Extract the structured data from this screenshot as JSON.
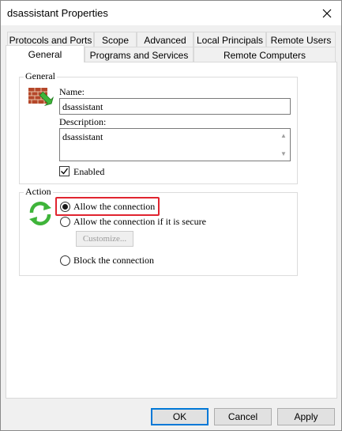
{
  "window": {
    "title": "dsassistant Properties"
  },
  "tabs_row1": [
    "Protocols and Ports",
    "Scope",
    "Advanced",
    "Local Principals",
    "Remote Users"
  ],
  "tabs_row2": [
    "General",
    "Programs and Services",
    "Remote Computers"
  ],
  "active_tab": "General",
  "general": {
    "label": "General",
    "name_label": "Name:",
    "name_value": "dsassistant",
    "description_label": "Description:",
    "description_value": "dsassistant",
    "enabled_label": "Enabled",
    "enabled_checked": true
  },
  "action": {
    "label": "Action",
    "options": [
      {
        "label": "Allow the connection",
        "selected": true
      },
      {
        "label": "Allow the connection if it is secure",
        "selected": false
      },
      {
        "label": "Block the connection",
        "selected": false
      }
    ],
    "customize_label": "Customize..."
  },
  "buttons": {
    "ok": "OK",
    "cancel": "Cancel",
    "apply": "Apply"
  },
  "colors": {
    "highlight": "#e0242f",
    "default_button_border": "#0078d7",
    "accent_green": "#3fb43a",
    "brick": "#b5472a"
  }
}
